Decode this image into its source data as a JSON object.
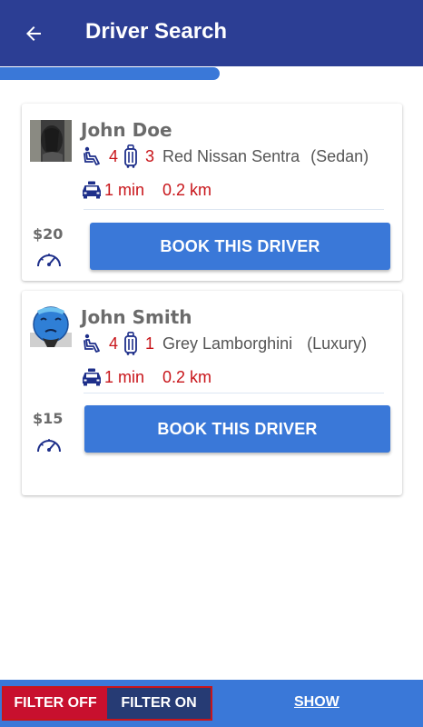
{
  "header": {
    "title": "Driver Search",
    "back_icon": "arrow-left-icon"
  },
  "progress": {
    "fraction": 0.52
  },
  "drivers": [
    {
      "name": "John Doe",
      "seats": "4",
      "luggage": "3",
      "vehicle": "Red Nissan Sentra",
      "vehicle_class": "(Sedan)",
      "eta": "1 min",
      "distance": "0.2 km",
      "price": "$20",
      "book_label": "BOOK THIS DRIVER"
    },
    {
      "name": "John Smith",
      "seats": "4",
      "luggage": "1",
      "vehicle": "Grey Lamborghini",
      "vehicle_class": "(Luxury)",
      "eta": "1 min",
      "distance": "0.2 km",
      "price": "$15",
      "book_label": "BOOK THIS DRIVER"
    }
  ],
  "footer": {
    "filter_off_label": "FILTER OFF",
    "filter_on_label": "FILTER ON",
    "show_label": "SHOW"
  },
  "colors": {
    "primary": "#2c3e94",
    "accent": "#3a78d8",
    "alert": "#c8151a"
  }
}
